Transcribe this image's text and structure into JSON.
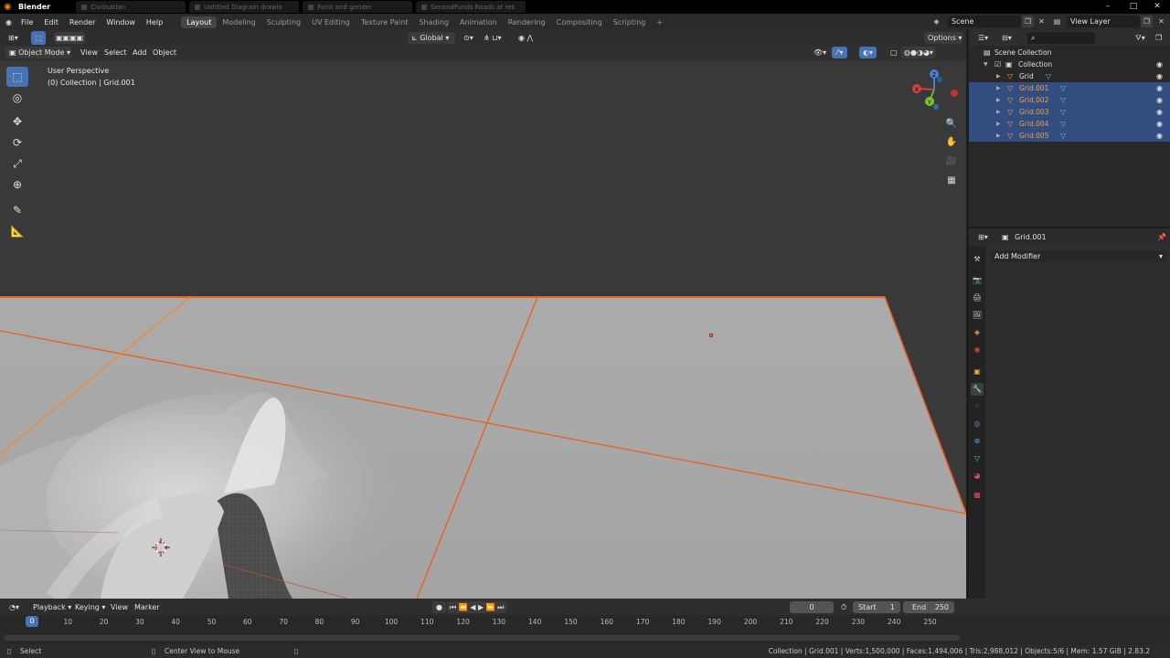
{
  "titlebar": {
    "app_title": "Blender",
    "browser_tabs": [
      "Civilisation",
      "Untitled Diagram drawio",
      "Paint and gender",
      "SecondFunds Roads at res"
    ],
    "window_controls": [
      "–",
      "□",
      "✕"
    ]
  },
  "menu": {
    "file": "File",
    "edit": "Edit",
    "render": "Render",
    "window": "Window",
    "help": "Help"
  },
  "workspaces": [
    "Layout",
    "Modeling",
    "Sculpting",
    "UV Editing",
    "Texture Paint",
    "Shading",
    "Animation",
    "Rendering",
    "Compositing",
    "Scripting",
    "+"
  ],
  "scene": {
    "scene_name": "Scene",
    "view_layer": "View Layer"
  },
  "viewport_header": {
    "transform_orientation": "Global",
    "options": "Options",
    "mode": "Object Mode",
    "view": "View",
    "select": "Select",
    "add": "Add",
    "object": "Object"
  },
  "viewport": {
    "perspective": "User Perspective",
    "collection_info": "(0) Collection | Grid.001",
    "gizmo_axes": {
      "x": "X",
      "y": "Y",
      "z": "Z"
    }
  },
  "tools": [
    "select-box",
    "cursor",
    "move",
    "rotate",
    "scale",
    "transform",
    "annotate",
    "measure"
  ],
  "outliner": {
    "search_placeholder": "",
    "scene_collection": "Scene Collection",
    "collection": "Collection",
    "items": [
      {
        "name": "Grid",
        "selected": false
      },
      {
        "name": "Grid.001",
        "selected": true
      },
      {
        "name": "Grid.002",
        "selected": true
      },
      {
        "name": "Grid.003",
        "selected": true
      },
      {
        "name": "Grid.004",
        "selected": true
      },
      {
        "name": "Grid.005",
        "selected": true
      }
    ]
  },
  "properties": {
    "object_name": "Grid.001",
    "add_modifier": "Add Modifier"
  },
  "timeline": {
    "playback": "Playback",
    "keying": "Keying",
    "view": "View",
    "marker": "Marker",
    "current_frame": "0",
    "start_label": "Start",
    "start_value": "1",
    "end_label": "End",
    "end_value": "250",
    "ticks": [
      "0",
      "10",
      "20",
      "30",
      "40",
      "50",
      "60",
      "70",
      "80",
      "90",
      "100",
      "110",
      "120",
      "130",
      "140",
      "150",
      "160",
      "170",
      "180",
      "190",
      "200",
      "210",
      "220",
      "230",
      "240",
      "250"
    ]
  },
  "statusbar": {
    "select": "Select",
    "center_view": "Center View to Mouse",
    "stats": "Collection | Grid.001 | Verts:1,500,000 | Faces:1,494,006 | Tris:2,988,012 | Objects:5/6 | Mem: 1.57 GiB | 2.83.2"
  },
  "colors": {
    "accent_blue": "#4772b3",
    "selection_orange": "#f0632f",
    "selected_row": "#334d80",
    "viewport_bg": "#393939"
  }
}
